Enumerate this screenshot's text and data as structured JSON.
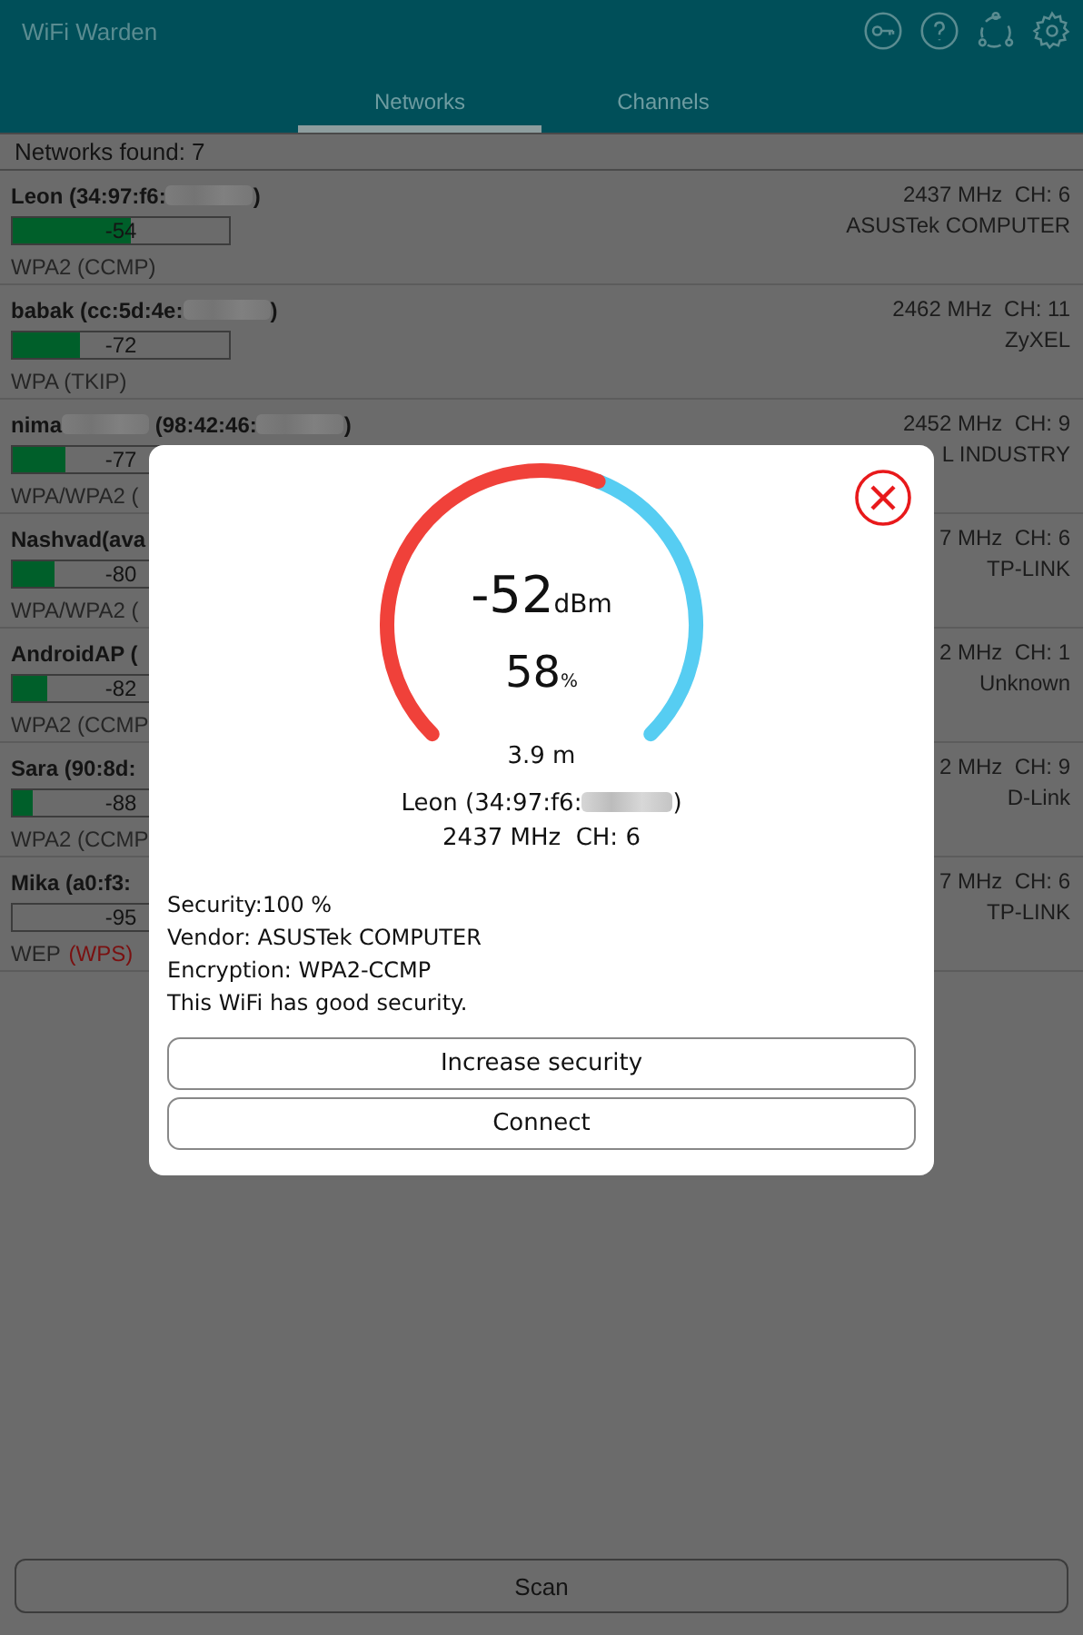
{
  "app": {
    "title": "WiFi Warden"
  },
  "tabs": [
    {
      "label": "Networks",
      "selected": true
    },
    {
      "label": "Channels",
      "selected": false
    }
  ],
  "summary": "Networks found: 7",
  "networks": [
    {
      "name": [
        {
          "kind": "text",
          "text": "Leon (34:97:f6:"
        },
        {
          "kind": "redacted"
        },
        {
          "kind": "text",
          "text": ")"
        }
      ],
      "level": 0.55,
      "reading": "-54",
      "encryption": "WPA2 (CCMP)",
      "frequency": "2437 MHz  CH: 6",
      "vendor": "ASUSTek COMPUTER"
    },
    {
      "name": [
        {
          "kind": "text",
          "text": "babak (cc:5d:4e:"
        },
        {
          "kind": "redacted"
        },
        {
          "kind": "text",
          "text": ")"
        }
      ],
      "level": 0.31,
      "reading": "-72",
      "encryption": "WPA (TKIP)",
      "frequency": "2462 MHz  CH: 11",
      "vendor": "ZyXEL"
    },
    {
      "name": [
        {
          "kind": "text",
          "text": "nima"
        },
        {
          "kind": "redacted"
        },
        {
          "kind": "text",
          "text": " (98:42:46:"
        },
        {
          "kind": "redacted"
        },
        {
          "kind": "text",
          "text": ")"
        }
      ],
      "level": 0.24,
      "reading": "-77",
      "encryption": "WPA/WPA2 (",
      "frequency": "2452 MHz  CH: 9",
      "vendor": "L INDUSTRY"
    },
    {
      "name": [
        {
          "kind": "text",
          "text": "Nashvad(ava"
        }
      ],
      "level": 0.19,
      "reading": "-80",
      "encryption": "WPA/WPA2 (",
      "frequency": "7 MHz  CH: 6",
      "vendor": "TP-LINK"
    },
    {
      "name": [
        {
          "kind": "text",
          "text": "AndroidAP ("
        }
      ],
      "level": 0.16,
      "reading": "-82",
      "encryption": "WPA2 (CCMP",
      "frequency": "2 MHz  CH: 1",
      "vendor": "Unknown"
    },
    {
      "name": [
        {
          "kind": "text",
          "text": "Sara (90:8d:"
        }
      ],
      "level": 0.09,
      "reading": "-88",
      "encryption": "WPA2 (CCMP",
      "frequency": "2 MHz  CH: 9",
      "vendor": "D-Link"
    },
    {
      "name": [
        {
          "kind": "text",
          "text": "Mika (a0:f3:"
        }
      ],
      "level": 0,
      "reading": "-95",
      "encryption": "WEP",
      "warning": "(WPS)",
      "frequency": "7 MHz  CH: 6",
      "vendor": "TP-LINK"
    }
  ],
  "dialog": {
    "rssi": "-52",
    "rssi_unit": "dBm",
    "percent": "58",
    "percent_unit": "%",
    "distance": "3.9 m",
    "name": [
      {
        "kind": "text",
        "text": "Leon (34:97:f6:"
      },
      {
        "kind": "redacted"
      },
      {
        "kind": "text",
        "text": ")"
      }
    ],
    "frequency": "2437 MHz  CH: 6",
    "details": [
      "Security:100 %",
      "Vendor: ASUSTek COMPUTER",
      "Encryption: WPA2-CCMP",
      "This WiFi has good security."
    ],
    "buttons": [
      "Increase security",
      "Connect"
    ]
  },
  "scan_button": "Scan"
}
